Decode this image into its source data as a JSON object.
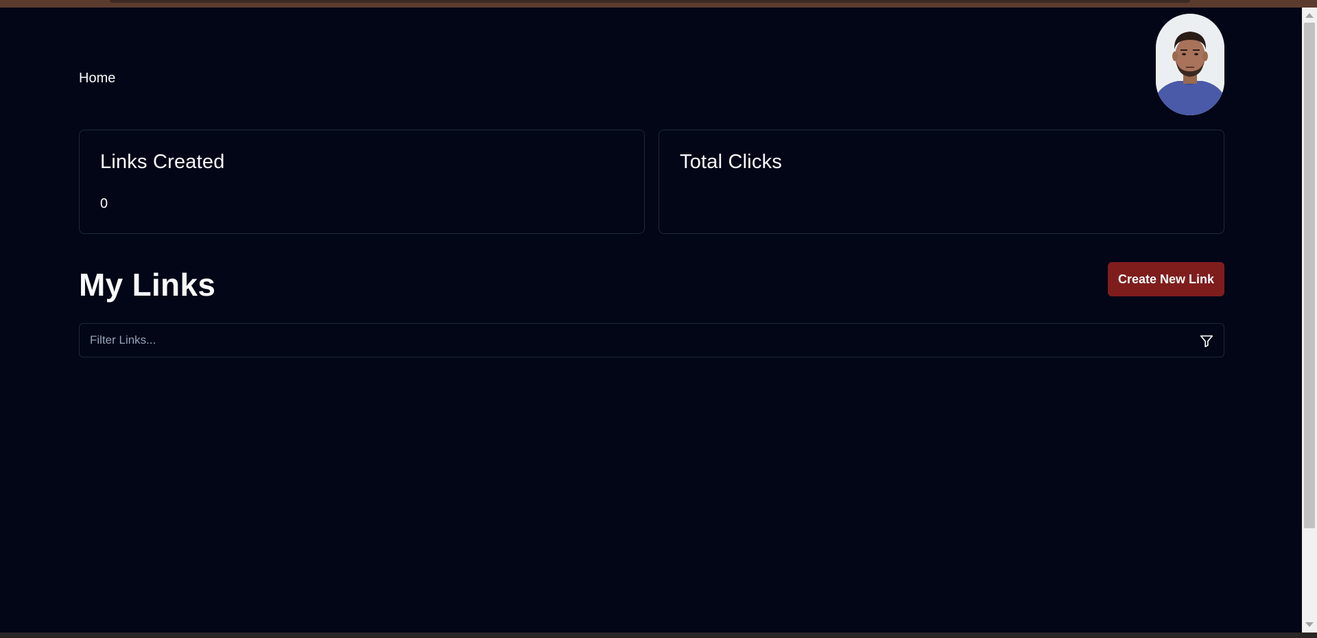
{
  "nav": {
    "home_label": "Home"
  },
  "user": {
    "avatar_icon": "user-avatar-photo"
  },
  "stats": {
    "links_created": {
      "title": "Links Created",
      "value": "0"
    },
    "total_clicks": {
      "title": "Total Clicks",
      "value": ""
    }
  },
  "links": {
    "heading": "My Links",
    "create_button_label": "Create New Link"
  },
  "filter": {
    "placeholder": "Filter Links...",
    "value": "",
    "icon": "filter-icon"
  },
  "colors": {
    "background": "#020617",
    "card_border": "#1e293b",
    "accent_button": "#7f1d1d",
    "text": "#f8fafc",
    "placeholder": "#94a3b8"
  }
}
